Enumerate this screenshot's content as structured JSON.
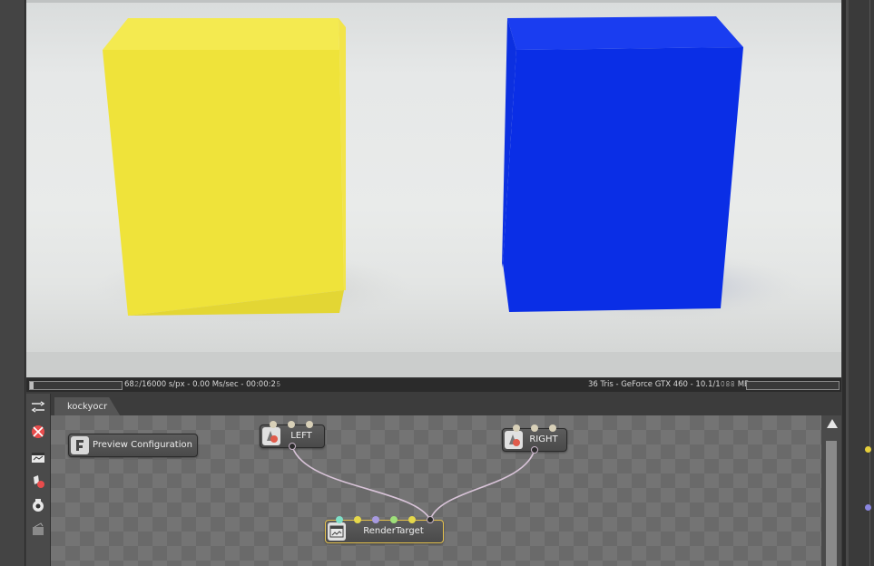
{
  "viewport": {
    "scene": "yellow and blue boxes on light backdrop",
    "colors": {
      "yellow_box": "#f2e63c",
      "blue_box": "#0a2ee6"
    }
  },
  "statusbar": {
    "left_text": "68𝟸/16000 s/px - 0.00 Ms/sec - 00:00:2𝟻",
    "right_text": "36 Tris - GeForce GTX 460 - 10.1/1𝟶𝟾𝟾 MB",
    "left_progress": 0.04,
    "right_progress": 0.0
  },
  "toolbar": {
    "tools": [
      "graph-tools-icon",
      "render-icon",
      "film-icon",
      "material-icon",
      "camera-icon",
      "settings-icon"
    ]
  },
  "editor": {
    "tab_label": "kockyocr",
    "nodes": {
      "preview": {
        "label": "Preview Configuration",
        "icon": "config-icon"
      },
      "left": {
        "label": "LEFT",
        "icon": "camera-node-icon"
      },
      "right": {
        "label": "RIGHT",
        "icon": "camera-node-icon"
      },
      "render": {
        "label": "RenderTarget",
        "icon": "render-target-icon"
      }
    },
    "pin_colors": [
      "#7fe0c8",
      "#e6d94a",
      "#a79ae0",
      "#9ee07a",
      "#e6d94a",
      "#2b2b2b"
    ],
    "wire_color": "#d9c4d9"
  },
  "right_panel": {
    "dot_colors": [
      "#e6cf3a",
      "#8a86e0"
    ]
  }
}
